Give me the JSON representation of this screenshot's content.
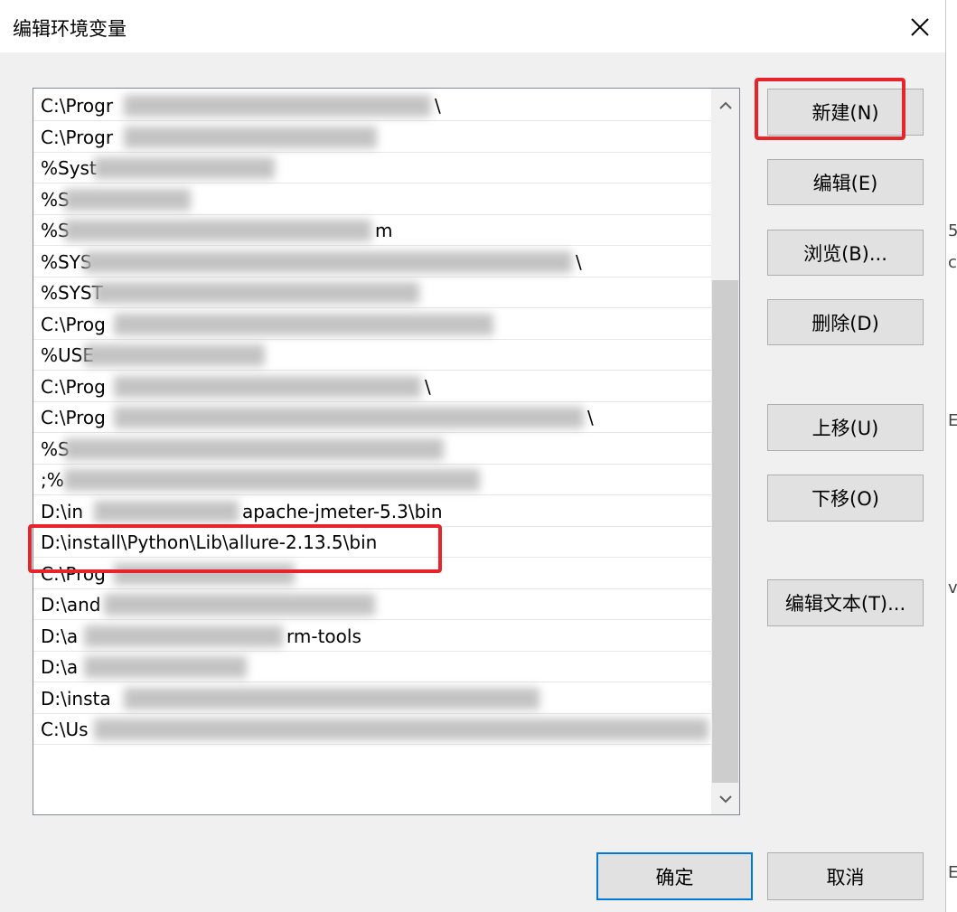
{
  "window": {
    "title": "编辑环境变量",
    "close_icon": "close-icon"
  },
  "path_list": {
    "items": [
      "C:\\Progr",
      "C:\\Progr",
      "%Syst",
      "%S",
      "%S",
      "%SYS",
      "%SYST",
      "C:\\Prog",
      "%USE",
      "C:\\Prog",
      "C:\\Prog",
      "%S",
      ";%",
      "D:\\in",
      "D:\\install\\Python\\Lib\\allure-2.13.5\\bin",
      "C:\\Prog",
      "D:\\and",
      "D:\\a",
      "D:\\a",
      "D:\\insta",
      "C:\\Us"
    ],
    "item_tails": {
      "0": "\\",
      "4": "m",
      "5": "\\",
      "9": "\\",
      "10": "\\",
      "13": "apache-jmeter-5.3\\bin",
      "17": "rm-tools",
      "20": "\\"
    }
  },
  "buttons": {
    "new": "新建(N)",
    "edit": "编辑(E)",
    "browse": "浏览(B)...",
    "delete": "删除(D)",
    "move_up": "上移(U)",
    "move_down": "下移(O)",
    "edit_text": "编辑文本(T)...",
    "ok": "确定",
    "cancel": "取消"
  },
  "colors": {
    "highlight": "#e8242a",
    "primary_border": "#0078d7"
  }
}
